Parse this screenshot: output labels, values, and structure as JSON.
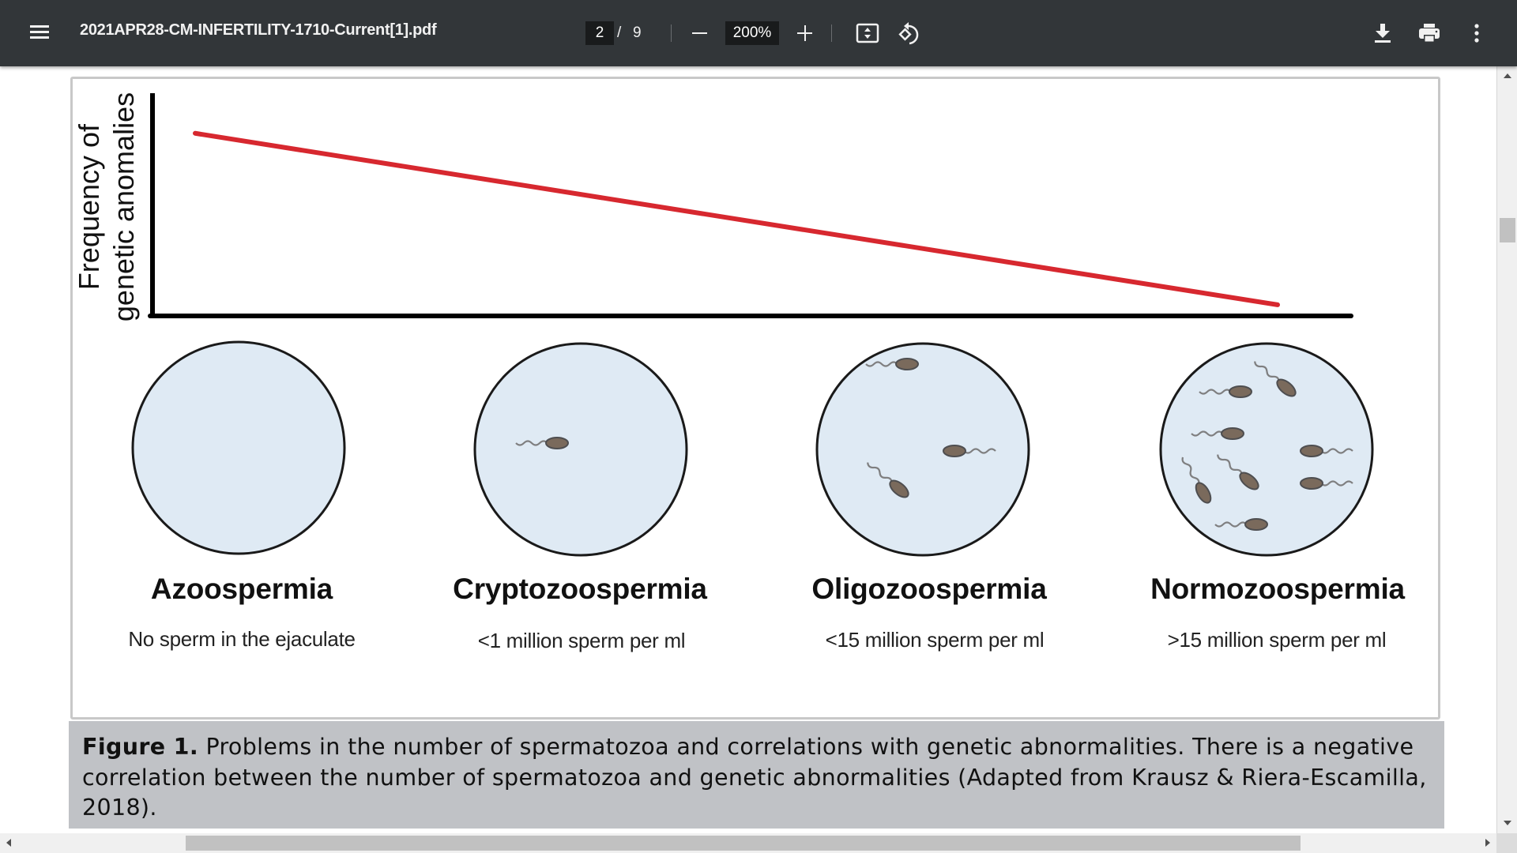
{
  "toolbar": {
    "title": "2021APR28-CM-INFERTILITY-1710-Current[1].pdf",
    "current_page": "2",
    "page_separator": "/",
    "total_pages": "9",
    "zoom_level": "200%",
    "icons": {
      "menu": "hamburger-menu-icon",
      "zoom_out": "minus-icon",
      "zoom_in": "plus-icon",
      "fit": "fit-to-page-icon",
      "rotate": "rotate-counterclockwise-icon",
      "download": "download-icon",
      "print": "print-icon",
      "more": "more-vertical-icon"
    }
  },
  "figure": {
    "y_axis_label_line1": "Frequency of",
    "y_axis_label_line2": "genetic anomalies",
    "line_color": "#d7282f",
    "circle_fill": "#dfeaf4",
    "categories": [
      {
        "name": "Azoospermia",
        "description": "No sperm in the ejaculate",
        "sperm_count_shown": 0
      },
      {
        "name": "Cryptozoospermia",
        "description": "<1 million sperm per ml",
        "sperm_count_shown": 1
      },
      {
        "name": "Oligozoospermia",
        "description": "<15 million sperm per ml",
        "sperm_count_shown": 3
      },
      {
        "name": "Normozoospermia",
        "description": ">15 million sperm per ml",
        "sperm_count_shown": 8
      }
    ],
    "caption_label": "Figure 1.",
    "caption_text": " Problems in the number of spermatozoa and correlations with genetic abnormalities. There is a negative correlation between the number of spermatozoa and genetic abnormalities (Adapted from Krausz & Riera-Escamilla, 2018)."
  },
  "chart_data": {
    "type": "line",
    "title": "",
    "xlabel": "",
    "ylabel": "Frequency of genetic anomalies",
    "categories": [
      "Azoospermia",
      "Cryptozoospermia",
      "Oligozoospermia",
      "Normozoospermia"
    ],
    "series": [
      {
        "name": "Frequency of genetic anomalies (relative)",
        "x": [
          0,
          1
        ],
        "values": [
          0.82,
          0.05
        ]
      }
    ],
    "xlim": [
      0,
      1
    ],
    "ylim": [
      0,
      1
    ],
    "grid": false,
    "legend": "none",
    "note": "Qualitative trend: frequency decreases as sperm count increases; no tick labels shown"
  }
}
